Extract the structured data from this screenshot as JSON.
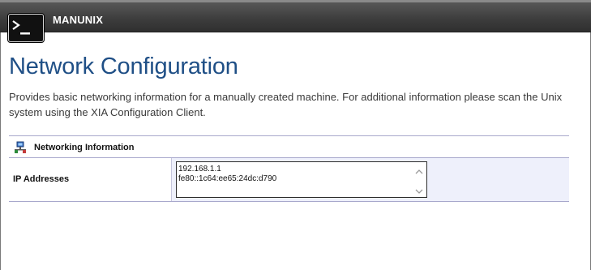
{
  "app": {
    "title": "MANUNIX",
    "icon": "terminal-icon"
  },
  "page": {
    "title": "Network Configuration",
    "description": "Provides basic networking information for a manually created machine. For additional information please scan the Unix system using the XIA Configuration Client."
  },
  "section": {
    "title": "Networking Information",
    "icon": "network-icon",
    "rows": [
      {
        "label": "IP Addresses",
        "values": [
          "192.168.1.1",
          "fe80::1c64:ee65:24dc:d790"
        ]
      }
    ]
  },
  "colors": {
    "title_blue": "#1f4f86",
    "header_bar": "#3d3d3d",
    "row_value_bg": "#eef0fb",
    "divider": "#a8a8cc"
  }
}
